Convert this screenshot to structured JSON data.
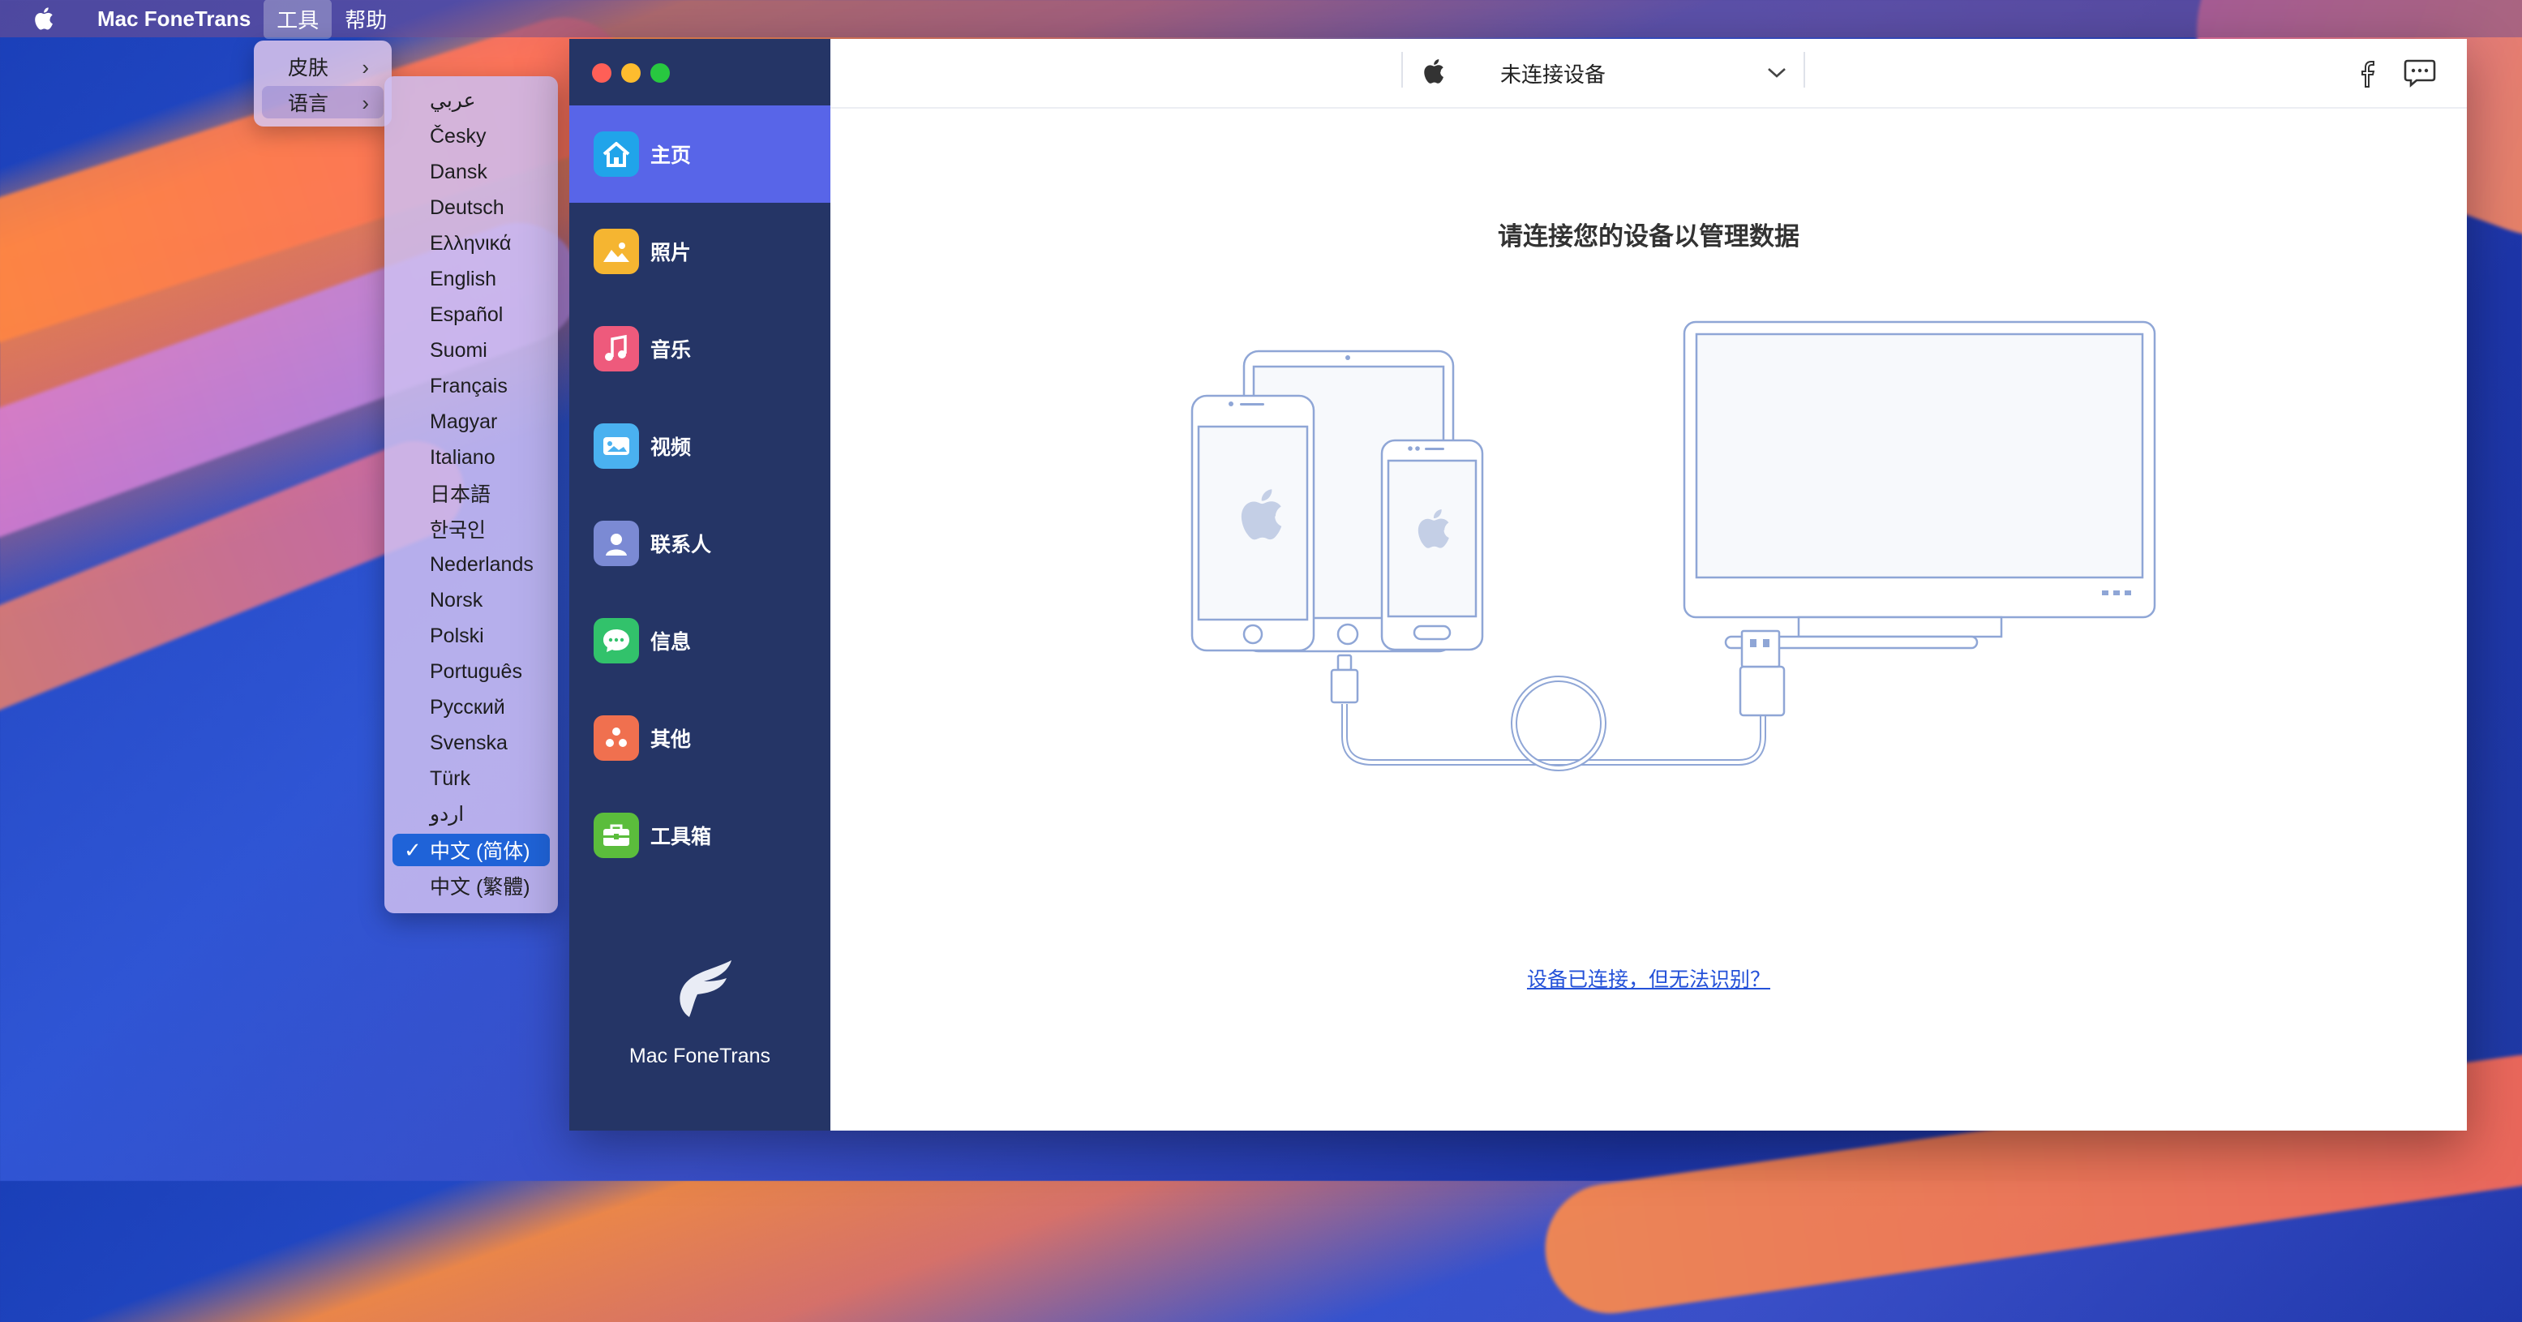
{
  "menubar": {
    "app_name": "Mac FoneTrans",
    "items": [
      "工具",
      "帮助"
    ]
  },
  "tools_menu": {
    "items": [
      {
        "label": "皮肤",
        "has_submenu": true
      },
      {
        "label": "语言",
        "has_submenu": true,
        "highlighted": true
      }
    ]
  },
  "language_menu": {
    "items": [
      "عربي",
      "Česky",
      "Dansk",
      "Deutsch",
      "Ελληνικά",
      "English",
      "Español",
      "Suomi",
      "Français",
      "Magyar",
      "Italiano",
      "日本語",
      "한국인",
      "Nederlands",
      "Norsk",
      "Polski",
      "Português",
      "Русский",
      "Svenska",
      "Türk",
      "اردو",
      "中文 (简体)",
      "中文 (繁體)"
    ],
    "selected": "中文 (简体)"
  },
  "sidebar": {
    "items": [
      {
        "label": "主页",
        "icon": "home-icon",
        "color": "#20a4ea",
        "active": true
      },
      {
        "label": "照片",
        "icon": "photo-icon",
        "color": "#f5b531"
      },
      {
        "label": "音乐",
        "icon": "music-icon",
        "color": "#ee5a7c"
      },
      {
        "label": "视频",
        "icon": "video-icon",
        "color": "#4ab1f0"
      },
      {
        "label": "联系人",
        "icon": "contacts-icon",
        "color": "#7b8ad4"
      },
      {
        "label": "信息",
        "icon": "message-icon",
        "color": "#32c26b"
      },
      {
        "label": "其他",
        "icon": "other-icon",
        "color": "#f0704f"
      },
      {
        "label": "工具箱",
        "icon": "toolbox-icon",
        "color": "#5bbd3c"
      }
    ],
    "brand": "Mac FoneTrans"
  },
  "header": {
    "device_status": "未连接设备"
  },
  "main": {
    "title": "请连接您的设备以管理数据",
    "help_link": "设备已连接，但无法识别？"
  },
  "colors": {
    "sidebar_bg": "#253566",
    "sidebar_active": "#5865e8",
    "link": "#2451d8",
    "menu_selected": "#1f63d8"
  }
}
